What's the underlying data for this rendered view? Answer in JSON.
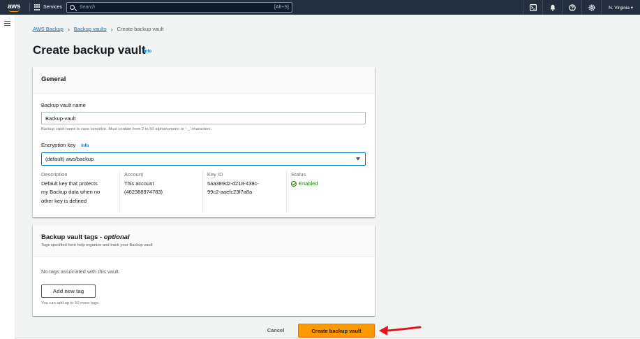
{
  "topnav": {
    "logo_text": "aws",
    "services_label": "Services",
    "search_placeholder": "Search",
    "search_shortcut": "[Alt+S]",
    "region": "N. Virginia ▾"
  },
  "breadcrumb": {
    "items": [
      "AWS Backup",
      "Backup vaults"
    ],
    "current": "Create backup vault"
  },
  "page": {
    "title": "Create backup vault",
    "info": "Info"
  },
  "general": {
    "title": "General",
    "vault_name_label": "Backup vault name",
    "vault_name_value": "Backup-vault",
    "vault_name_constraint": "Backup vault name is case sensitive. Must contain from 2 to 50 alphanumeric or '-_' characters.",
    "encryption_label": "Encryption key",
    "encryption_info": "Info",
    "encryption_value": "(default) aws/backup",
    "details": {
      "description_key": "Description",
      "description_line1": "Default key that protects",
      "description_line2": "my Backup data when no",
      "description_line3": "other key is defined",
      "account_key": "Account",
      "account_line1": "This account",
      "account_line2": "(462388974783)",
      "keyid_key": "Key ID",
      "keyid_line1": "5aa389d2-d218-438c-",
      "keyid_line2": "99c2-aaefc23f7a8a",
      "status_key": "Status",
      "status_value": "Enabled"
    }
  },
  "tags": {
    "title": "Backup vault tags - ",
    "title_optional": "optional",
    "description": "Tags specified here help organize and track your Backup vault",
    "empty": "No tags associated with this vault.",
    "add_button": "Add new tag",
    "hint": "You can add up to 50 more tags."
  },
  "footer": {
    "cancel": "Cancel",
    "create": "Create backup vault"
  },
  "colors": {
    "accent_orange": "#ff9900",
    "link_blue": "#0073bb",
    "nav_dark": "#232f3e",
    "success_green": "#1d8102",
    "arrow_red": "#e0141e"
  }
}
